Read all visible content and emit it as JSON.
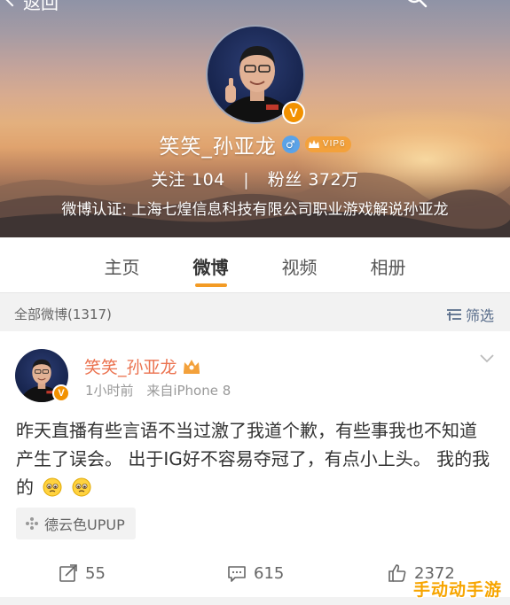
{
  "header": {
    "back_label": "返回",
    "profile_name": "笑笑_孙亚龙",
    "vip_label": "VIP6",
    "avatar_badge": "V",
    "stats": {
      "follow_label": "关注",
      "follow_count": "104",
      "fans_label": "粉丝",
      "fans_count": "372万",
      "separator": "|"
    },
    "verification": "微博认证: 上海七煌信息科技有限公司职业游戏解说孙亚龙"
  },
  "tabs": [
    {
      "label": "主页",
      "active": false
    },
    {
      "label": "微博",
      "active": true
    },
    {
      "label": "视频",
      "active": false
    },
    {
      "label": "相册",
      "active": false
    }
  ],
  "filter_bar": {
    "all_posts_label": "全部微博(1317)",
    "filter_label": "筛选"
  },
  "post": {
    "author": "笑笑_孙亚龙",
    "avatar_badge": "V",
    "time": "1小时前",
    "source": "来自iPhone 8",
    "text_main": "昨天直播有些言语不当过激了我道个歉，有些事我也不知道 产生了误会。 出于IG好不容易夺冠了，有点小上头。 我的我的",
    "location_tag": "德云色UPUP",
    "actions": {
      "repost_count": "55",
      "comment_count": "615",
      "like_count": "2372"
    }
  },
  "watermark": "手动动手游",
  "colors": {
    "accent_orange": "#f39b25",
    "author_name": "#eb7350",
    "filter_blue": "#5a6e8c",
    "verified_badge": "#f29100"
  },
  "icons": {
    "back": "chevron-left-icon",
    "search": "search-icon",
    "gender": "male-icon",
    "vip": "vip-crown-icon",
    "filter": "filter-icon",
    "location": "location-tag-icon",
    "repost": "repost-icon",
    "comment": "comment-icon",
    "like": "thumbs-up-icon"
  }
}
